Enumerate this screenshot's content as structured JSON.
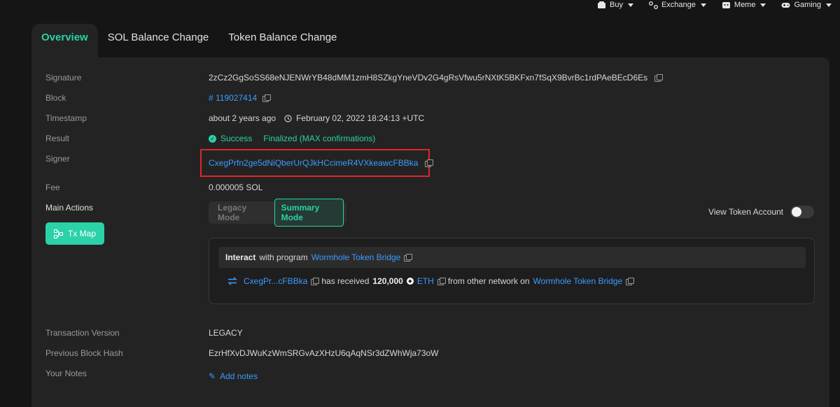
{
  "topnav": [
    {
      "label": "Buy",
      "icon": "buy-icon"
    },
    {
      "label": "Exchange",
      "icon": "exchange-icon"
    },
    {
      "label": "Meme",
      "icon": "meme-icon"
    },
    {
      "label": "Gaming",
      "icon": "gaming-icon"
    }
  ],
  "tabs": [
    {
      "label": "Overview"
    },
    {
      "label": "SOL Balance Change"
    },
    {
      "label": "Token Balance Change"
    }
  ],
  "fields": {
    "signature": {
      "label": "Signature",
      "value": "2zCz2GgSoSS68eNJENWrYB48dMM1zmH8SZkgYneVDv2G4gRsVfwu5rNXtK5BKFxn7fSqX9BvrBc1rdPAeBEcD6Es"
    },
    "block": {
      "label": "Block",
      "value": "# 119027414"
    },
    "timestamp": {
      "label": "Timestamp",
      "relative": "about 2 years ago",
      "absolute": "February 02, 2022 18:24:13 +UTC"
    },
    "result": {
      "label": "Result",
      "status": "Success",
      "finality": "Finalized (MAX confirmations)"
    },
    "signer": {
      "label": "Signer",
      "value": "CxegPrfn2ge5dNiQberUrQJkHCcimeR4VXkeawcFBBka"
    },
    "fee": {
      "label": "Fee",
      "value": "0.000005 SOL"
    },
    "main_actions": {
      "label": "Main Actions"
    },
    "tx_version": {
      "label": "Transaction Version",
      "value": "LEGACY"
    },
    "prev_block_hash": {
      "label": "Previous Block Hash",
      "value": "EzrHfXvDJWuKzWmSRGvAzXHzU6qAqNSr3dZWhWja73oW"
    },
    "notes": {
      "label": "Your Notes",
      "action": "Add notes"
    }
  },
  "mode": {
    "legacy": "Legacy Mode",
    "summary": "Summary Mode"
  },
  "view_token_account": "View Token Account",
  "tx_map_label": "Tx Map",
  "actions": {
    "interact_prefix": "Interact",
    "interact_mid": "with program",
    "program": "Wormhole Token Bridge",
    "account": "CxegPr...cFBBka",
    "received_text": "has received",
    "amount": "120,000",
    "token": "ETH",
    "from_text": "from other network on",
    "bridge": "Wormhole Token Bridge"
  },
  "colors": {
    "accent": "#2bd1a7",
    "link": "#3b9bff",
    "highlight": "#e0252b"
  }
}
